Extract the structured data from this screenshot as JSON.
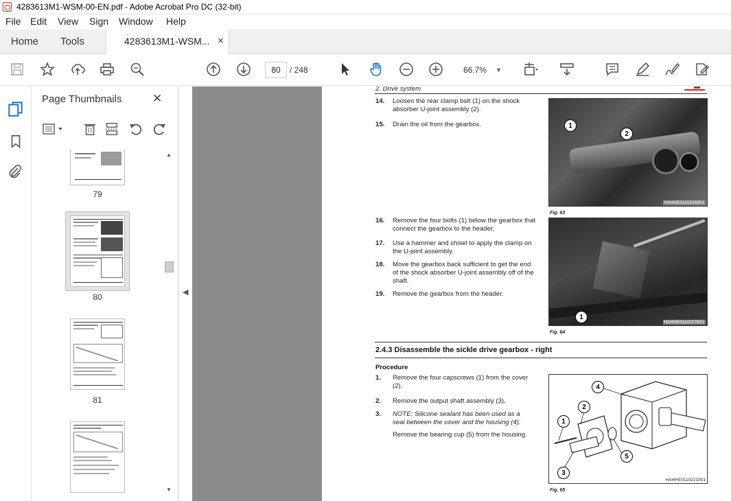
{
  "window": {
    "title": "4283613M1-WSM-00-EN.pdf - Adobe Acrobat Pro DC (32-bit)"
  },
  "menu": [
    "File",
    "Edit",
    "View",
    "Sign",
    "Window",
    "Help"
  ],
  "tabs": {
    "home": "Home",
    "tools": "Tools",
    "doc": "4283613M1-WSM...",
    "close": "×"
  },
  "toolbar": {
    "page_current": "80",
    "page_total": "/ 248",
    "zoom": "66.7%"
  },
  "panel": {
    "title": "Page Thumbnails",
    "close": "✕",
    "thumbs": [
      "79",
      "80",
      "81"
    ]
  },
  "doc": {
    "header": "2. Drive system",
    "steps_a": [
      {
        "n": "14.",
        "t": "Loosen the rear clamp bolt (1) on the shock absorber U-joint assembly (2)."
      },
      {
        "n": "15.",
        "t": "Drain the oil from the gearbox."
      }
    ],
    "fig63": "Fig. 63",
    "code63": "HAHHE0110226901",
    "steps_b": [
      {
        "n": "16.",
        "t": "Remove the four bolts (1) below the gearbox that connect the gearbox to the header."
      },
      {
        "n": "17.",
        "t": "Use a hammer and chisel to apply the clamp on the U-joint assembly."
      },
      {
        "n": "18.",
        "t": "Move the gearbox back sufficient to get the end of the shock absorber U-joint assembly off of the shaft."
      },
      {
        "n": "19.",
        "t": "Remove the gearbox from the header."
      }
    ],
    "fig64": "Fig. 64",
    "code64": "HAHHE0110227801",
    "section": "2.4.3  Disassemble the sickle drive gearbox - right",
    "procedure": "Procedure",
    "steps_c": [
      {
        "n": "1.",
        "t": "Remove the four capscrews (1) from the cover (2)."
      },
      {
        "n": "2.",
        "t": "Remove the output shaft assembly (3)."
      },
      {
        "n": "3.",
        "t": "NOTE: Silicone sealant has been used as a seal between the cover and the housing (4)."
      }
    ],
    "step_c3b": "Remove the bearing cup (5) from the housing.",
    "fig65": "Fig. 65",
    "code65": "HAHHE0110221001",
    "callouts63": [
      "1",
      "2"
    ],
    "callouts64": [
      "1"
    ],
    "callouts65": [
      "1",
      "2",
      "3",
      "4",
      "5"
    ]
  }
}
